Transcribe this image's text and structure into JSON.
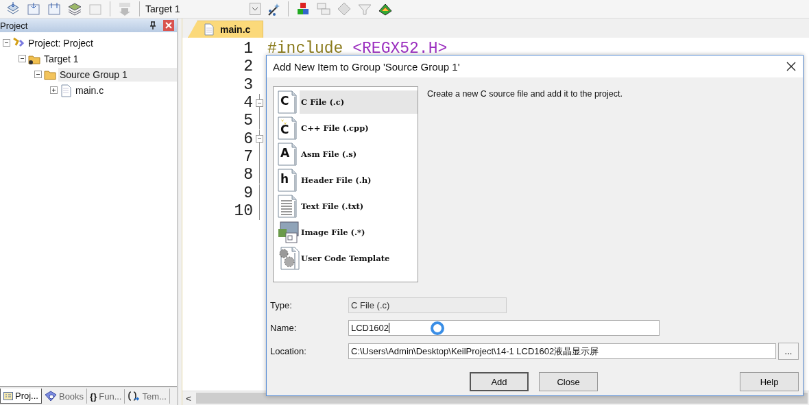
{
  "toolbar": {
    "target": "Target 1"
  },
  "project_panel": {
    "title": "Project",
    "tree": [
      {
        "label": "Project: Project",
        "kind": "project",
        "expanded": true,
        "selected": false,
        "children": [
          {
            "label": "Target 1",
            "kind": "target",
            "expanded": true,
            "selected": false,
            "children": [
              {
                "label": "Source Group 1",
                "kind": "group",
                "expanded": true,
                "selected": true,
                "children": [
                  {
                    "label": "main.c",
                    "kind": "file",
                    "expanded": false,
                    "selected": false
                  }
                ]
              }
            ]
          }
        ]
      }
    ],
    "tabs": [
      {
        "label": "Proj...",
        "kind": "project",
        "selected": true
      },
      {
        "label": "Books",
        "kind": "books",
        "selected": false
      },
      {
        "label": "Fun...",
        "kind": "functions",
        "glyph": "{}",
        "selected": false
      },
      {
        "label": "Tem...",
        "kind": "templates",
        "selected": false
      }
    ]
  },
  "editor": {
    "tabs": [
      {
        "label": "main.c",
        "selected": true
      }
    ],
    "lines": [
      {
        "number": "1",
        "fold": false,
        "code": [
          {
            "kind": "directive",
            "text": "#include"
          },
          {
            "kind": "header",
            "text": "<REGX52.H>"
          }
        ]
      },
      {
        "number": "2",
        "fold": false
      },
      {
        "number": "3",
        "fold": false
      },
      {
        "number": "4",
        "fold": true
      },
      {
        "number": "5",
        "fold": false
      },
      {
        "number": "6",
        "fold": true
      },
      {
        "number": "7",
        "fold": false
      },
      {
        "number": "8",
        "fold": false
      },
      {
        "number": "9",
        "fold": false
      },
      {
        "number": "10",
        "fold": false
      }
    ],
    "scroll_left": "<"
  },
  "dialog": {
    "title": "Add New Item to Group 'Source Group 1'",
    "items": [
      {
        "label": "C File (.c)",
        "kind": "letter",
        "glyph": "C",
        "selected": true
      },
      {
        "label": "C++ File (.cpp)",
        "kind": "cpp",
        "glyph": "C",
        "selected": false
      },
      {
        "label": "Asm File (.s)",
        "kind": "letter",
        "glyph": "A",
        "selected": false
      },
      {
        "label": "Header File (.h)",
        "kind": "letter",
        "glyph": "h",
        "selected": false
      },
      {
        "label": "Text File (.txt)",
        "kind": "text",
        "selected": false
      },
      {
        "label": "Image File (.*)",
        "kind": "image",
        "selected": false
      },
      {
        "label": "User Code Template",
        "kind": "template",
        "selected": false
      }
    ],
    "description": "Create a new C source file and add it to the project.",
    "fields": [
      {
        "label": "Type:",
        "value": "C File (.c)",
        "disabled": true
      },
      {
        "label": "Name:",
        "value": "LCD1602",
        "disabled": false,
        "busy": true
      },
      {
        "label": "Location:",
        "value": "C:\\Users\\Admin\\Desktop\\KeilProject\\14-1 LCD1602液晶显示屏",
        "disabled": false,
        "browse": "..."
      }
    ],
    "buttons": [
      {
        "label": "Add",
        "default": true
      },
      {
        "label": "Close",
        "default": false
      },
      {
        "label": "Help",
        "default": false
      }
    ]
  }
}
